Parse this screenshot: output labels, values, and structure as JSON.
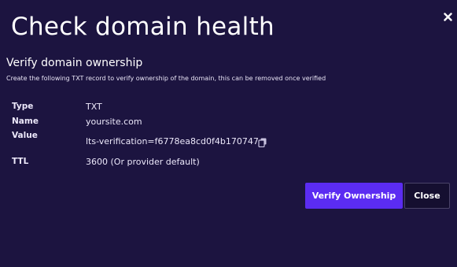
{
  "modal": {
    "title": "Check domain health",
    "close_icon": "close-icon"
  },
  "section": {
    "heading": "Verify domain ownership",
    "description": "Create the following TXT record to verify ownership of the domain, this can be removed once verified"
  },
  "record": {
    "type_label": "Type",
    "type_value": "TXT",
    "name_label": "Name",
    "name_value": "yoursite.com",
    "value_label": "Value",
    "value_value": "lts-verification=f6778ea8cd0f4b170747",
    "copy_icon": "copy-icon",
    "ttl_label": "TTL",
    "ttl_value": "3600 (Or provider default)"
  },
  "actions": {
    "verify_label": "Verify Ownership",
    "close_label": "Close"
  },
  "colors": {
    "background": "#1c1440",
    "primary": "#5b2cf2",
    "secondary_border": "#4a4368"
  }
}
